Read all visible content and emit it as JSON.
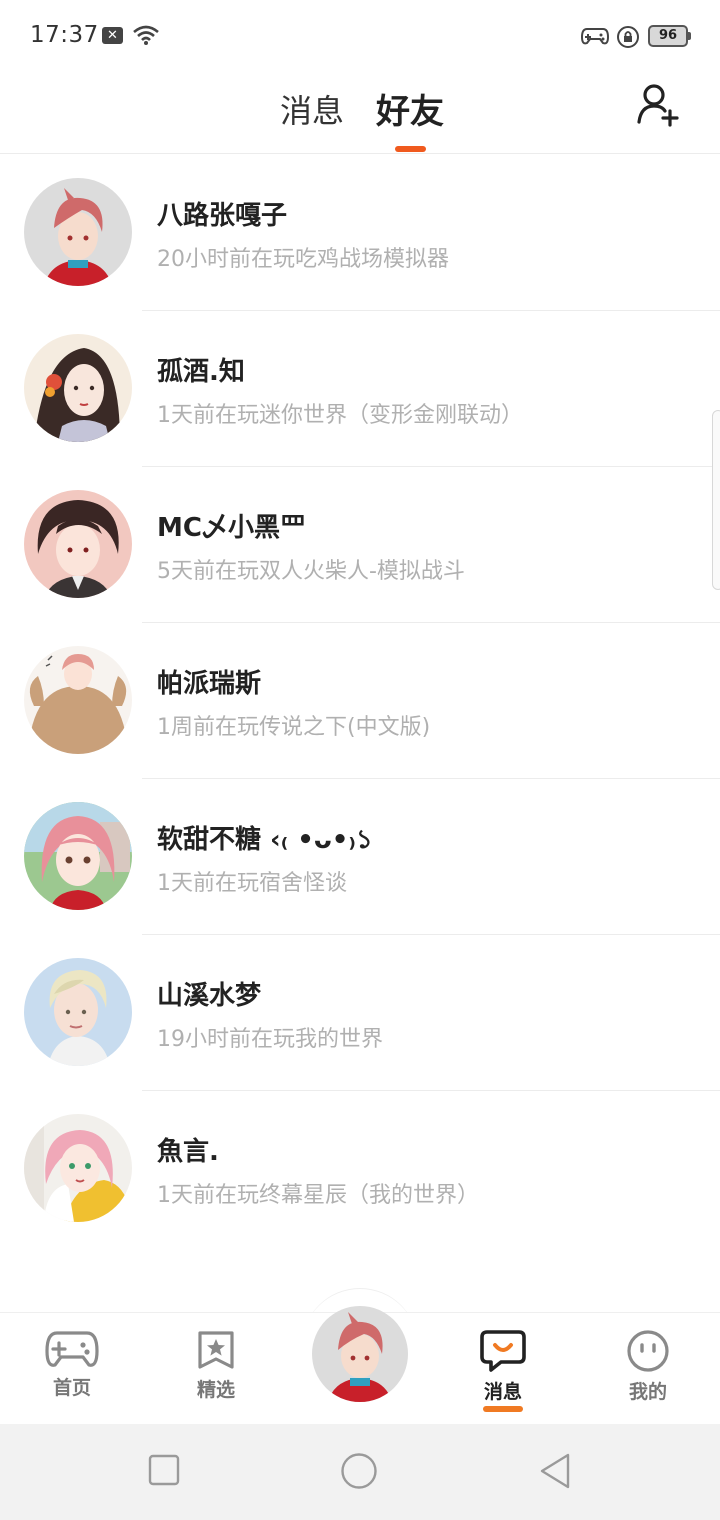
{
  "status_bar": {
    "time": "17:37",
    "notification_icon": "x-box-icon",
    "battery": "96"
  },
  "top_tabs": {
    "messages": "消息",
    "friends": "好友",
    "active": "friends",
    "accent": "#f05a1e"
  },
  "friends": [
    {
      "name": "八路张嘎子",
      "status": "20小时前在玩吃鸡战场模拟器"
    },
    {
      "name": "孤酒.知",
      "status": "1天前在玩迷你世界（变形金刚联动）"
    },
    {
      "name": "MC乄小黑罒",
      "status": "5天前在玩双人火柴人-模拟战斗"
    },
    {
      "name": "帕派瑞斯",
      "status": "1周前在玩传说之下(中文版)"
    },
    {
      "name": "软甜不糖 ‹₍ •ᴗ•₎১",
      "status": "1天前在玩宿舍怪谈"
    },
    {
      "name": "山溪水梦",
      "status": "19小时前在玩我的世界"
    },
    {
      "name": "魚言.",
      "status": "1天前在玩终幕星辰（我的世界）"
    }
  ],
  "bottom_nav": {
    "home": "首页",
    "featured": "精选",
    "messages": "消息",
    "mine": "我的",
    "active": "messages",
    "accent": "#f07a23"
  },
  "colors": {
    "text_primary": "#222222",
    "text_secondary": "#b0b0b0",
    "divider": "#ececec"
  }
}
